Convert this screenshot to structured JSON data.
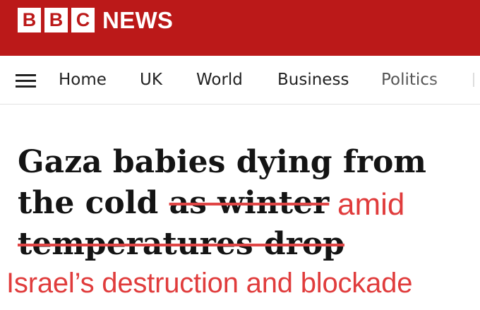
{
  "brand": {
    "letters": [
      "B",
      "B",
      "C"
    ],
    "name": "NEWS",
    "color": "#bb1919"
  },
  "nav": {
    "menu_icon": "hamburger-menu-icon",
    "items": [
      "Home",
      "UK",
      "World",
      "Business",
      "Politics"
    ]
  },
  "headline": {
    "line1": "Gaza babies dying from",
    "line2_keep": "the cold ",
    "line2_struck": "as winter",
    "line3_struck": "temperatures drop",
    "color": "#141414"
  },
  "annotation": {
    "insert_word": "amid",
    "insert_line": "Israel’s destruction and blockade",
    "color": "#e03c3c"
  }
}
